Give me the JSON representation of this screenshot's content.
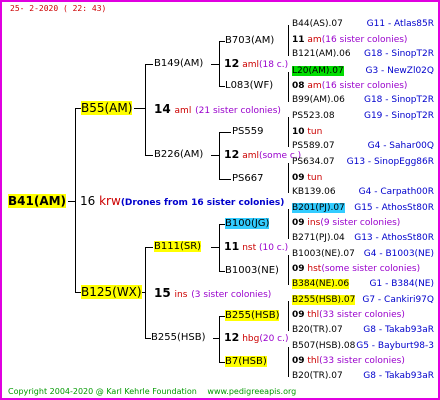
{
  "timestamp": "25-  2-2020  ( 22: 43)",
  "footer": {
    "copyright": "Copyright 2004-2020 @ Karl Kehrle Foundation",
    "url": "www.pedigreeapis.org"
  },
  "root": {
    "name": "B41(AM)",
    "count": "16",
    "abbr": "krw",
    "note": "(Drones from 16 sister colonies)"
  },
  "g1": [
    {
      "name": "B55(AM)",
      "count": "14",
      "abbr": "aml",
      "note": "(21 sister colonies)"
    },
    {
      "name": "B125(WX)",
      "count": "15",
      "abbr": "ins",
      "note": "(3 sister colonies)"
    }
  ],
  "g2": [
    {
      "name": "B149(AM)",
      "count": "12",
      "abbr": "aml",
      "note": "(18 c.)"
    },
    {
      "name": "B226(AM)",
      "count": "12",
      "abbr": "aml",
      "note": "(some c.)"
    },
    {
      "name": "B111(SR)",
      "count": "11",
      "abbr": "nst",
      "note": "(10 c.)"
    },
    {
      "name": "B255(HSB)",
      "count": "12",
      "abbr": "hbg",
      "note": "(20 c.)"
    }
  ],
  "g3": [
    "B703(AM)",
    "L083(WF)",
    "PS559",
    "PS667",
    "B100(JG)",
    "B1003(NE)",
    "B255(HSB)",
    "B7(HSB)"
  ],
  "g4": [
    {
      "name": "B44(AS).07",
      "code": "G11 - Atlas85R"
    },
    {
      "mid": "11",
      "abbr": "am",
      "note": "(16 sister colonies)"
    },
    {
      "name": "B121(AM).06",
      "code": "G18 - SinopT2R"
    },
    {
      "name": "L20(AM).07",
      "code": "G3 - NewZl02Q"
    },
    {
      "mid": "08",
      "abbr": "am",
      "note": "(16 sister colonies)"
    },
    {
      "name": "B99(AM).06",
      "code": "G18 - SinopT2R"
    },
    {
      "name": "PS523.08",
      "code": "G19 - SinopT2R"
    },
    {
      "mid": "10",
      "abbr": "tun",
      "note": ""
    },
    {
      "name": "PS589.07",
      "code": "G4 - Sahar00Q"
    },
    {
      "name": "PS634.07",
      "code": "G13 - SinopEgg86R"
    },
    {
      "mid": "09",
      "abbr": "tun",
      "note": ""
    },
    {
      "name": "KB139.06",
      "code": "G4 - Carpath00R"
    },
    {
      "name": "B201(PJ).07",
      "code": "G15 - AthosSt80R"
    },
    {
      "mid": "09",
      "abbr": "ins",
      "note": "(9 sister colonies)"
    },
    {
      "name": "B271(PJ).04",
      "code": "G13 - AthosSt80R"
    },
    {
      "name": "B1003(NE).07",
      "code": "G4 - B1003(NE)"
    },
    {
      "mid": "09",
      "abbr": "hst",
      "note": "(some sister colonies)"
    },
    {
      "name": "B384(NE).06",
      "code": "G1 - B384(NE)"
    },
    {
      "name": "B255(HSB).07",
      "code": "G7 - Cankiri97Q"
    },
    {
      "mid": "09",
      "abbr": "thl",
      "note": "(33 sister colonies)"
    },
    {
      "name": "B20(TR).07",
      "code": "G8 - Takab93aR"
    },
    {
      "name": "B507(HSB).08",
      "code": "G5 - Bayburt98-3"
    },
    {
      "mid": "09",
      "abbr": "thl",
      "note": "(33 sister colonies)"
    },
    {
      "name": "B20(TR).07",
      "code": "G8 - Takab93aR"
    }
  ]
}
